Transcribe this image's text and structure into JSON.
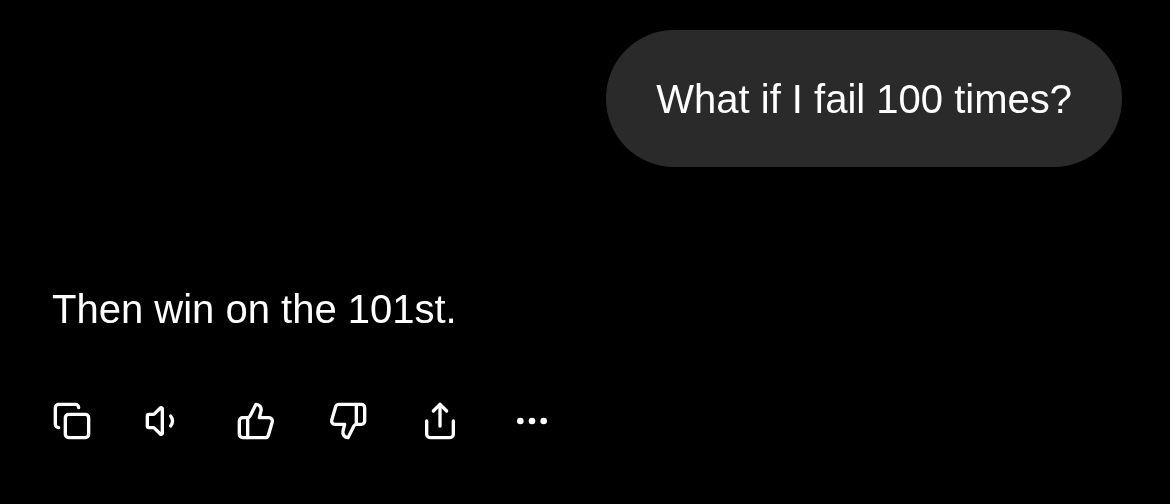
{
  "user_message": {
    "text": "What if I fail 100 times?"
  },
  "assistant_message": {
    "text": "Then win on the 101st."
  }
}
